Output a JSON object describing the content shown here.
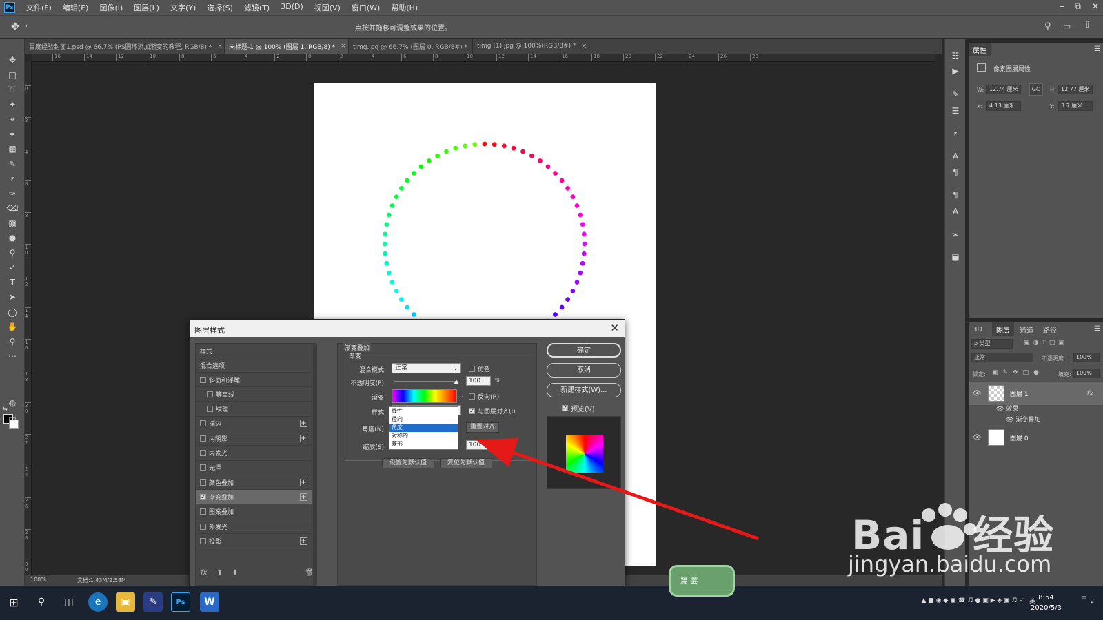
{
  "app": {
    "logo": "Ps"
  },
  "menu": [
    "文件(F)",
    "编辑(E)",
    "图像(I)",
    "图层(L)",
    "文字(Y)",
    "选择(S)",
    "滤镜(T)",
    "3D(D)",
    "视图(V)",
    "窗口(W)",
    "帮助(H)"
  ],
  "options_bar": {
    "hint": "点按并拖移可调整效果的位置。"
  },
  "tabs": [
    {
      "label": "百度经验封面1.psd @ 66.7% (PS圆环添加渐变的教程, RGB/8) *",
      "active": false
    },
    {
      "label": "未标题-1 @ 100% (图层 1, RGB/8) *",
      "active": true
    },
    {
      "label": "timg.jpg @ 66.7% (图层 0, RGB/8#) *",
      "active": false
    },
    {
      "label": "timg (1).jpg @ 100%(RGB/8#) *",
      "active": false
    }
  ],
  "ruler_top": [
    "16",
    "14",
    "12",
    "10",
    "8",
    "6",
    "4",
    "2",
    "0",
    "2",
    "4",
    "6",
    "8",
    "10",
    "12",
    "14",
    "16",
    "18",
    "20",
    "22",
    "24",
    "26",
    "28"
  ],
  "ruler_left": [
    "0",
    "2",
    "4",
    "6",
    "8",
    "1 0",
    "1 2",
    "1 4",
    "1 6",
    "1 8",
    "2 0",
    "2 2",
    "2 4",
    "2 6",
    "2 8",
    "3 0"
  ],
  "status": {
    "zoom": "100%",
    "doc": "文档:1.43M/2.58M"
  },
  "properties": {
    "tab": "属性",
    "title": "像素图层属性",
    "w_label": "W:",
    "w": "12.74 厘米",
    "h_label": "H:",
    "h": "12.77 厘米",
    "x_label": "X:",
    "x": "4.13 厘米",
    "y_label": "Y:",
    "y": "3.7 厘米",
    "link": "GO"
  },
  "layers_panel": {
    "tabs": [
      "3D",
      "图层",
      "通道",
      "路径"
    ],
    "active_tab": "图层",
    "search": "ρ 类型",
    "blend": "正常",
    "opacity_label": "不透明度:",
    "opacity": "100%",
    "lock_label": "锁定:",
    "fill_label": "填充:",
    "fill": "100%",
    "layers": [
      {
        "name": "图层 1",
        "fx": "fx"
      },
      {
        "name": "效果"
      },
      {
        "name": "渐变叠加"
      },
      {
        "name": "图层 0"
      }
    ]
  },
  "dialog": {
    "title": "图层样式",
    "styles_header": "样式",
    "blend_options": "混合选项",
    "items": [
      {
        "label": "斜面和浮雕",
        "checked": false,
        "plus": false,
        "indent": false
      },
      {
        "label": "等高线",
        "checked": false,
        "plus": false,
        "indent": true
      },
      {
        "label": "纹理",
        "checked": false,
        "plus": false,
        "indent": true
      },
      {
        "label": "描边",
        "checked": false,
        "plus": true,
        "indent": false
      },
      {
        "label": "内阴影",
        "checked": false,
        "plus": true,
        "indent": false
      },
      {
        "label": "内发光",
        "checked": false,
        "plus": false,
        "indent": false
      },
      {
        "label": "光泽",
        "checked": false,
        "plus": false,
        "indent": false
      },
      {
        "label": "颜色叠加",
        "checked": false,
        "plus": true,
        "indent": false
      },
      {
        "label": "渐变叠加",
        "checked": true,
        "plus": true,
        "indent": false
      },
      {
        "label": "图案叠加",
        "checked": false,
        "plus": false,
        "indent": false
      },
      {
        "label": "外发光",
        "checked": false,
        "plus": false,
        "indent": false
      },
      {
        "label": "投影",
        "checked": false,
        "plus": true,
        "indent": false
      }
    ],
    "footer_fx": "fx",
    "group_title": "渐变叠加",
    "sub_title": "渐变",
    "blend_mode_label": "混合模式:",
    "blend_mode": "正常",
    "dither": "仿色",
    "opacity_label": "不透明度(P):",
    "opacity": "100",
    "pct": "%",
    "gradient_label": "渐变:",
    "reverse": "反向(R)",
    "style_label": "样式:",
    "style": "角度",
    "align_layer": "与图层对齐(I)",
    "angle_label": "角度(N):",
    "reset_align": "重置对齐",
    "scale_label": "缩放(S):",
    "scale": "100",
    "style_options": [
      "线性",
      "径向",
      "角度",
      "对称的",
      "菱形"
    ],
    "set_default": "设置为默认值",
    "reset_default": "复位为默认值",
    "ok": "确定",
    "cancel": "取消",
    "new_style": "新建样式(W)...",
    "preview": "预览(V)"
  },
  "taskbar": {
    "time": "8:54",
    "date": "2020/5/3",
    "lang": "英",
    "notify": "2"
  },
  "watermark": {
    "brand": "Bai",
    "brand_cn": "经验",
    "url": "jingyan.baidu.com"
  },
  "badge": {
    "text": "篇 芸"
  }
}
